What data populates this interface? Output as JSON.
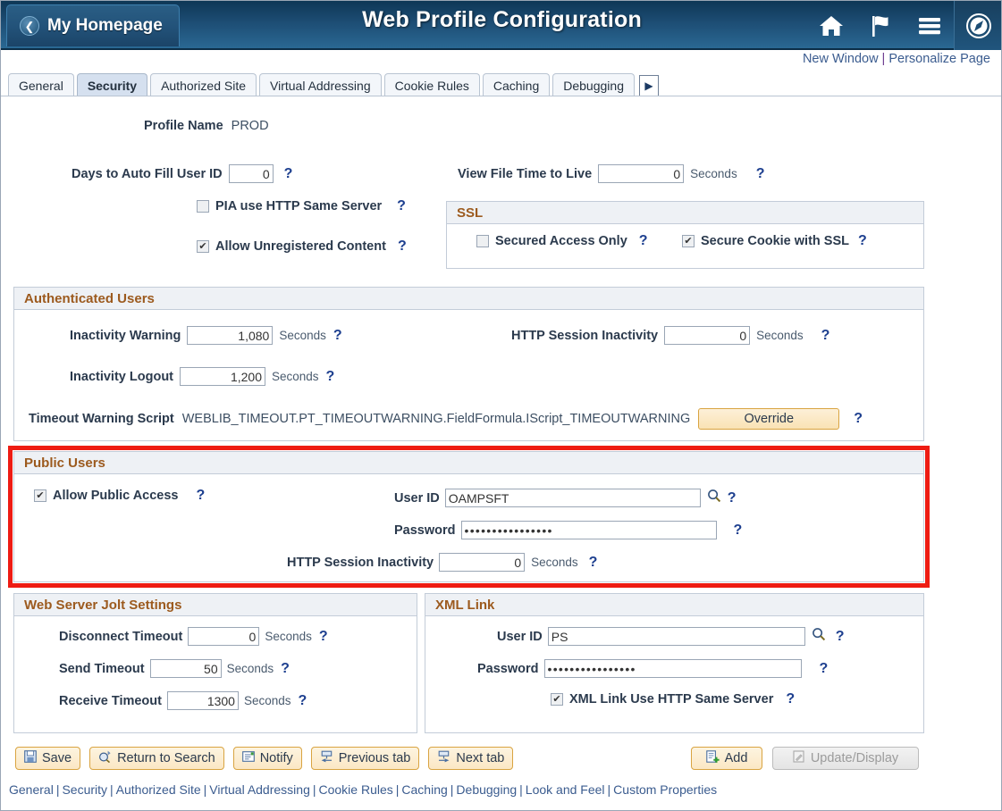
{
  "header": {
    "homepage_label": "My Homepage",
    "title": "Web Profile Configuration",
    "back_icon": "chevron-left-icon",
    "icons": [
      "home-icon",
      "flag-icon",
      "hamburger-menu-icon",
      "navigator-compass-icon"
    ]
  },
  "linkbar": {
    "new_window": "New Window",
    "separator": "|",
    "personalize": "Personalize Page"
  },
  "tabs": [
    {
      "label": "General",
      "active": false
    },
    {
      "label": "Security",
      "active": true
    },
    {
      "label": "Authorized Site",
      "active": false
    },
    {
      "label": "Virtual Addressing",
      "active": false
    },
    {
      "label": "Cookie Rules",
      "active": false
    },
    {
      "label": "Caching",
      "active": false
    },
    {
      "label": "Debugging",
      "active": false
    }
  ],
  "tab_next_arrow": "▶",
  "profile": {
    "label": "Profile Name",
    "value": "PROD"
  },
  "top": {
    "days_autofill_label": "Days to Auto Fill User ID",
    "days_autofill_value": "0",
    "view_file_ttl_label": "View File Time to Live",
    "view_file_ttl_value": "0",
    "seconds": "Seconds",
    "pia_same_server_label": "PIA use HTTP Same Server",
    "pia_same_server_checked": false,
    "allow_unregistered_label": "Allow Unregistered Content",
    "allow_unregistered_checked": true
  },
  "ssl": {
    "title": "SSL",
    "secured_access_label": "Secured Access Only",
    "secured_access_checked": false,
    "secure_cookie_label": "Secure Cookie with SSL",
    "secure_cookie_checked": true
  },
  "authenticated_users": {
    "title": "Authenticated Users",
    "inactivity_warning_label": "Inactivity Warning",
    "inactivity_warning_value": "1,080",
    "inactivity_logout_label": "Inactivity Logout",
    "inactivity_logout_value": "1,200",
    "http_session_inactivity_label": "HTTP Session Inactivity",
    "http_session_inactivity_value": "0",
    "seconds": "Seconds",
    "timeout_script_label": "Timeout Warning Script",
    "timeout_script_value": "WEBLIB_TIMEOUT.PT_TIMEOUTWARNING.FieldFormula.IScript_TIMEOUTWARNING",
    "override_label": "Override"
  },
  "public_users": {
    "title": "Public Users",
    "allow_public_label": "Allow Public Access",
    "allow_public_checked": true,
    "user_id_label": "User ID",
    "user_id_value": "OAMPSFT",
    "password_label": "Password",
    "password_value": "••••••••••••••••",
    "http_session_inactivity_label": "HTTP Session Inactivity",
    "http_session_inactivity_value": "0",
    "seconds": "Seconds",
    "lookup_icon": "search-magnifier-icon",
    "highlight_color": "#ee1c13"
  },
  "jolt": {
    "title": "Web Server Jolt Settings",
    "disconnect_label": "Disconnect Timeout",
    "disconnect_value": "0",
    "send_label": "Send Timeout",
    "send_value": "50",
    "receive_label": "Receive Timeout",
    "receive_value": "1300",
    "seconds": "Seconds"
  },
  "xml_link": {
    "title": "XML Link",
    "user_id_label": "User ID",
    "user_id_value": "PS",
    "password_label": "Password",
    "password_value": "••••••••••••••••",
    "same_server_label": "XML Link Use HTTP Same Server",
    "same_server_checked": true,
    "lookup_icon": "search-magnifier-icon"
  },
  "toolbar": {
    "save": "Save",
    "return_to_search": "Return to Search",
    "notify": "Notify",
    "previous_tab": "Previous tab",
    "next_tab": "Next tab",
    "add": "Add",
    "update_display": "Update/Display"
  },
  "footer_links": [
    "General",
    "Security",
    "Authorized Site",
    "Virtual Addressing",
    "Cookie Rules",
    "Caching",
    "Debugging",
    "Look and Feel",
    "Custom Properties"
  ],
  "footer_sep": "|",
  "help_glyph": "?"
}
